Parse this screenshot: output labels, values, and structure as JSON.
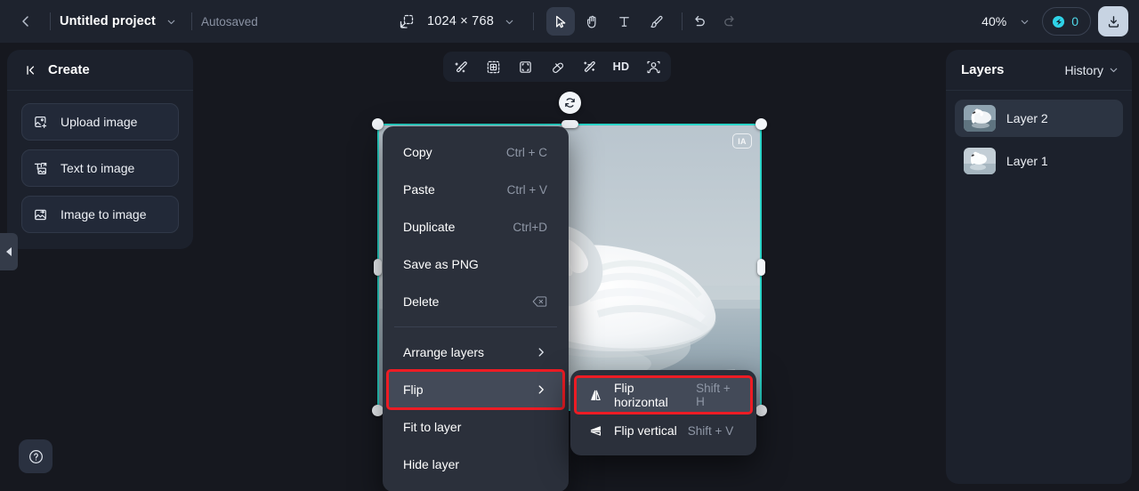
{
  "topbar": {
    "back_icon": "chevron-left-icon",
    "project_name": "Untitled project",
    "project_dropdown_icon": "chevron-down-icon",
    "autosaved_label": "Autosaved",
    "resolution_icon": "resize-icon",
    "resolution_value": "1024 × 768",
    "resolution_dropdown_icon": "chevron-down-icon",
    "tools": [
      {
        "name": "select-tool",
        "icon": "cursor-arrow-icon",
        "active": true
      },
      {
        "name": "hand-tool",
        "icon": "hand-icon",
        "active": false
      },
      {
        "name": "text-tool",
        "icon": "text-t-icon",
        "active": false
      },
      {
        "name": "brush-tool",
        "icon": "brush-icon",
        "active": false
      }
    ],
    "undo_icon": "undo-arrow-icon",
    "redo_icon": "redo-arrow-icon",
    "zoom_value": "40%",
    "zoom_dropdown_icon": "chevron-down-icon",
    "credits_icon": "credit-coin-icon",
    "credits_count": "0",
    "download_icon": "download-icon"
  },
  "left_panel": {
    "collapse_icon": "collapse-left-icon",
    "title": "Create",
    "items": [
      {
        "label": "Upload image",
        "icon": "image-upload-icon"
      },
      {
        "label": "Text to image",
        "icon": "text-to-image-icon"
      },
      {
        "label": "Image to image",
        "icon": "image-to-image-icon"
      }
    ],
    "collapse_tab_icon": "triangle-left-icon",
    "help_icon": "question-circle-icon"
  },
  "float_toolbar": {
    "buttons": [
      {
        "name": "magic-erase-button",
        "icon": "magic-wand-eraser-icon",
        "label": ""
      },
      {
        "name": "expand-button",
        "icon": "expand-frame-icon",
        "label": ""
      },
      {
        "name": "crop-button",
        "icon": "crop-frame-icon",
        "label": ""
      },
      {
        "name": "eraser-button",
        "icon": "eraser-icon",
        "label": ""
      },
      {
        "name": "enhance-button",
        "icon": "magic-sparkle-icon",
        "label": ""
      },
      {
        "name": "hd-button",
        "icon": "hd-text-icon",
        "label": "HD"
      },
      {
        "name": "remove-background-button",
        "icon": "person-cutout-icon",
        "label": ""
      }
    ]
  },
  "canvas": {
    "rotate_icon": "rotate-icon",
    "ia_badge": "IA",
    "selection_color": "#2ad4c8"
  },
  "context_menu": {
    "items": [
      {
        "label": "Copy",
        "shortcut": "Ctrl + C",
        "submenu": false,
        "highlight": false,
        "boxed": false
      },
      {
        "label": "Paste",
        "shortcut": "Ctrl + V",
        "submenu": false,
        "highlight": false,
        "boxed": false
      },
      {
        "label": "Duplicate",
        "shortcut": "Ctrl+D",
        "submenu": false,
        "highlight": false,
        "boxed": false
      },
      {
        "label": "Save as PNG",
        "shortcut": "",
        "submenu": false,
        "highlight": false,
        "boxed": false
      },
      {
        "label": "Delete",
        "shortcut": "",
        "icon": "backspace-icon",
        "submenu": false,
        "highlight": false,
        "boxed": false
      },
      {
        "label": "Arrange layers",
        "shortcut": "",
        "submenu": true,
        "highlight": false,
        "boxed": false
      },
      {
        "label": "Flip",
        "shortcut": "",
        "submenu": true,
        "highlight": true,
        "boxed": true
      },
      {
        "label": "Fit to layer",
        "shortcut": "",
        "submenu": false,
        "highlight": false,
        "boxed": false
      },
      {
        "label": "Hide layer",
        "shortcut": "",
        "submenu": false,
        "highlight": false,
        "boxed": false
      }
    ]
  },
  "submenu": {
    "items": [
      {
        "label": "Flip horizontal",
        "shortcut": "Shift + H",
        "icon": "flip-horizontal-icon",
        "highlight": true,
        "boxed": true
      },
      {
        "label": "Flip vertical",
        "shortcut": "Shift + V",
        "icon": "flip-vertical-icon",
        "highlight": false,
        "boxed": false
      }
    ]
  },
  "right_panel": {
    "title": "Layers",
    "history_label": "History",
    "history_dropdown_icon": "chevron-down-icon",
    "layers": [
      {
        "name": "Layer 2",
        "selected": true
      },
      {
        "name": "Layer 1",
        "selected": false
      }
    ]
  }
}
